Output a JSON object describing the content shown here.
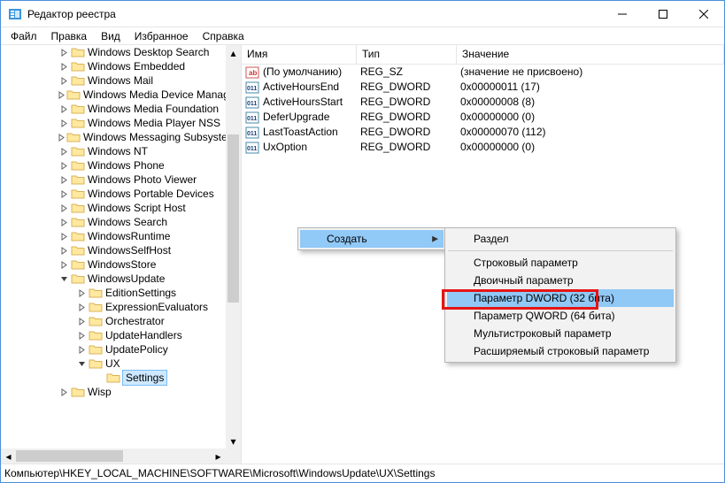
{
  "window": {
    "title": "Редактор реестра"
  },
  "menu": {
    "items": [
      "Файл",
      "Правка",
      "Вид",
      "Избранное",
      "Справка"
    ]
  },
  "tree": {
    "nodes": [
      {
        "d": 0,
        "t": "",
        "label": "Windows Desktop Search"
      },
      {
        "d": 0,
        "t": "",
        "label": "Windows Embedded"
      },
      {
        "d": 0,
        "t": "",
        "label": "Windows Mail"
      },
      {
        "d": 0,
        "t": "",
        "label": "Windows Media Device Manager"
      },
      {
        "d": 0,
        "t": "",
        "label": "Windows Media Foundation"
      },
      {
        "d": 0,
        "t": "",
        "label": "Windows Media Player NSS"
      },
      {
        "d": 0,
        "t": "",
        "label": "Windows Messaging Subsystem"
      },
      {
        "d": 0,
        "t": "",
        "label": "Windows NT"
      },
      {
        "d": 0,
        "t": "",
        "label": "Windows Phone"
      },
      {
        "d": 0,
        "t": "",
        "label": "Windows Photo Viewer"
      },
      {
        "d": 0,
        "t": "",
        "label": "Windows Portable Devices"
      },
      {
        "d": 0,
        "t": "",
        "label": "Windows Script Host"
      },
      {
        "d": 0,
        "t": "",
        "label": "Windows Search"
      },
      {
        "d": 0,
        "t": "",
        "label": "WindowsRuntime"
      },
      {
        "d": 0,
        "t": "",
        "label": "WindowsSelfHost"
      },
      {
        "d": 0,
        "t": "",
        "label": "WindowsStore"
      },
      {
        "d": 0,
        "t": "open",
        "label": "WindowsUpdate"
      },
      {
        "d": 1,
        "t": "",
        "label": "EditionSettings"
      },
      {
        "d": 1,
        "t": "",
        "label": "ExpressionEvaluators"
      },
      {
        "d": 1,
        "t": "",
        "label": "Orchestrator"
      },
      {
        "d": 1,
        "t": "",
        "label": "UpdateHandlers"
      },
      {
        "d": 1,
        "t": "",
        "label": "UpdatePolicy"
      },
      {
        "d": 1,
        "t": "open",
        "label": "UX"
      },
      {
        "d": 2,
        "t": "none",
        "label": "Settings",
        "selected": true
      },
      {
        "d": 0,
        "t": "",
        "label": "Wisp"
      }
    ]
  },
  "columns": {
    "name": "Имя",
    "type": "Тип",
    "value": "Значение"
  },
  "rows": [
    {
      "icon": "str",
      "name": "(По умолчанию)",
      "type": "REG_SZ",
      "value": "(значение не присвоено)"
    },
    {
      "icon": "bin",
      "name": "ActiveHoursEnd",
      "type": "REG_DWORD",
      "value": "0x00000011 (17)"
    },
    {
      "icon": "bin",
      "name": "ActiveHoursStart",
      "type": "REG_DWORD",
      "value": "0x00000008 (8)"
    },
    {
      "icon": "bin",
      "name": "DeferUpgrade",
      "type": "REG_DWORD",
      "value": "0x00000000 (0)"
    },
    {
      "icon": "bin",
      "name": "LastToastAction",
      "type": "REG_DWORD",
      "value": "0x00000070 (112)"
    },
    {
      "icon": "bin",
      "name": "UxOption",
      "type": "REG_DWORD",
      "value": "0x00000000 (0)"
    }
  ],
  "context": {
    "primary": {
      "create": "Создать"
    },
    "submenu": [
      {
        "label": "Раздел",
        "sep": true
      },
      {
        "label": "Строковый параметр"
      },
      {
        "label": "Двоичный параметр"
      },
      {
        "label": "Параметр DWORD (32 бита)",
        "hl": true
      },
      {
        "label": "Параметр QWORD (64 бита)"
      },
      {
        "label": "Мультистроковый параметр"
      },
      {
        "label": "Расширяемый строковый параметр"
      }
    ]
  },
  "status": {
    "path": "Компьютер\\HKEY_LOCAL_MACHINE\\SOFTWARE\\Microsoft\\WindowsUpdate\\UX\\Settings"
  }
}
